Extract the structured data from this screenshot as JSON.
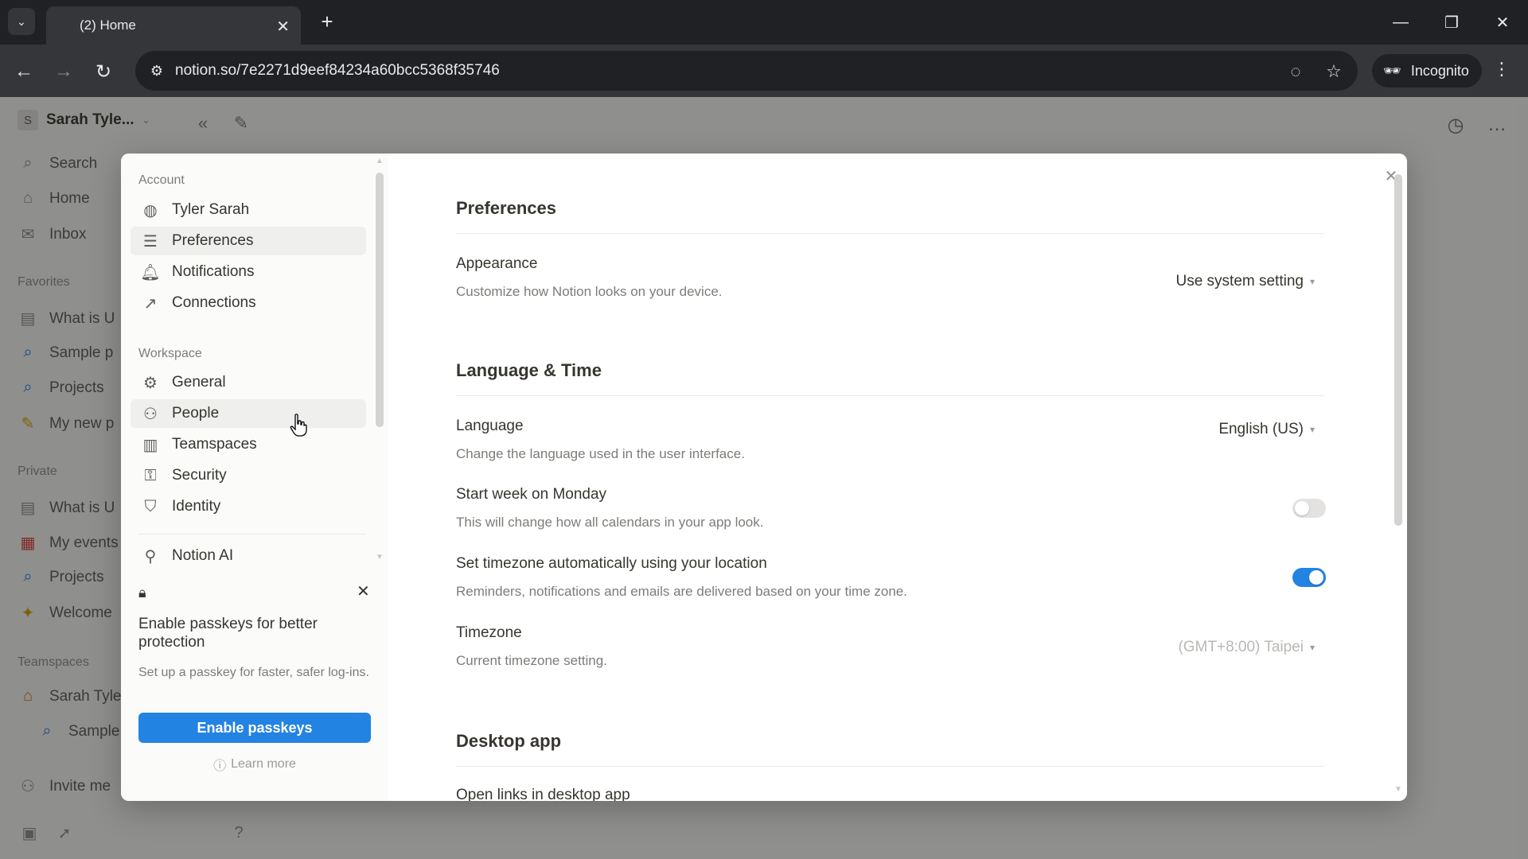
{
  "browser": {
    "tab_title": "(2) Home",
    "url": "notion.so/7e2271d9eef84234a60bcc5368f35746",
    "incognito_label": "Incognito"
  },
  "sidebar": {
    "workspace_name": "Sarah Tyle...",
    "workspace_initial": "S",
    "top_items": [
      "Search",
      "Home",
      "Inbox"
    ],
    "favorites_label": "Favorites",
    "favorites": [
      "What is U",
      "Sample p",
      "Projects",
      "My new p"
    ],
    "private_label": "Private",
    "private": [
      "What is U",
      "My events",
      "Projects",
      "Welcome"
    ],
    "teamspaces_label": "Teamspaces",
    "teamspaces": [
      "Sarah Tyle",
      "Sample"
    ],
    "invite_label": "Invite me"
  },
  "settings": {
    "account_label": "Account",
    "user_name": "Tyler Sarah",
    "account_items": [
      "Preferences",
      "Notifications",
      "Connections"
    ],
    "workspace_label": "Workspace",
    "workspace_items": [
      "General",
      "People",
      "Teamspaces",
      "Security",
      "Identity"
    ],
    "ai_item": "Notion AI",
    "active_item": "Preferences",
    "hovered_item": "People",
    "passkey": {
      "title": "Enable passkeys for better protection",
      "description": "Set up a passkey for faster, safer log-ins.",
      "button": "Enable passkeys",
      "learn_more": "Learn more"
    },
    "main": {
      "preferences_title": "Preferences",
      "appearance_label": "Appearance",
      "appearance_desc": "Customize how Notion looks on your device.",
      "appearance_value": "Use system setting",
      "lang_time_title": "Language & Time",
      "language_label": "Language",
      "language_desc": "Change the language used in the user interface.",
      "language_value": "English (US)",
      "start_week_label": "Start week on Monday",
      "start_week_desc": "This will change how all calendars in your app look.",
      "start_week_on": false,
      "auto_tz_label": "Set timezone automatically using your location",
      "auto_tz_desc": "Reminders, notifications and emails are delivered based on your time zone.",
      "auto_tz_on": true,
      "timezone_label": "Timezone",
      "timezone_desc": "Current timezone setting.",
      "timezone_value": "(GMT+8:00) Taipei",
      "desktop_title": "Desktop app",
      "open_links_label": "Open links in desktop app"
    }
  },
  "colors": {
    "accent": "#2383e2",
    "chrome_bg": "#202124",
    "chrome_toolbar": "#35363a"
  }
}
